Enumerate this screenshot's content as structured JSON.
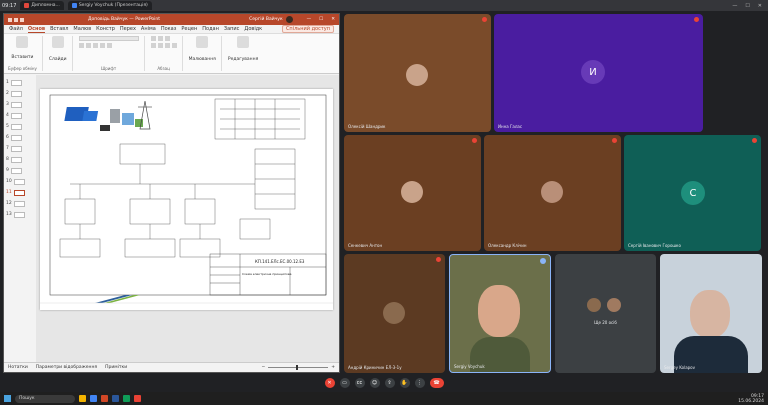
{
  "browser": {
    "clock": "09:17",
    "tabs": [
      {
        "label": "Дипломна..."
      },
      {
        "label": "Sergiy Voychuk (Презентація)"
      }
    ]
  },
  "ppt": {
    "title_doc": "Доповідь Вайчук — PowerPoint",
    "user_name": "Сергій Вайчук",
    "menu": [
      "Файл",
      "Основ",
      "Вставл",
      "Малюв",
      "Констр",
      "Перех",
      "Аніма",
      "Показ",
      "Рецен",
      "Подан",
      "Запис",
      "Довідк"
    ],
    "share": "Спільний доступ",
    "ribbon": {
      "paste": "Вставити",
      "clipboard": "Буфер обміну",
      "slides": "Слайди",
      "font": "Шрифт",
      "paragraph": "Абзац",
      "drawing": "Малювання",
      "editing": "Редагування"
    },
    "thumb_numbers": [
      "7",
      "8",
      "9",
      "10",
      "11",
      "12",
      "13"
    ],
    "thumb_numbers_top": [
      "1",
      "2",
      "3",
      "4",
      "5",
      "6"
    ],
    "slide": {
      "stamp_code": "КП.141.ЕЛс.ЕС.00.12.Е3",
      "stamp_desc": "Схема електрична принципова"
    },
    "status": {
      "notes": "Нотатки",
      "display": "Параметри відображення",
      "comments": "Примітки"
    }
  },
  "participants": [
    {
      "name": "Олексій Шандрик"
    },
    {
      "name": "Инна Галас",
      "initial": "И",
      "color": "#673ab7"
    },
    {
      "name": "Сенкевич Антон"
    },
    {
      "name": "Олександр Клічин"
    },
    {
      "name": "Сергій Іванович Горошко",
      "initial": "С",
      "color": "#1e8f7c"
    },
    {
      "name": "Андрій Криничин ЕЛ-3-1у"
    },
    {
      "name": "Sergiy Voychuk"
    },
    {
      "name": "Ще 20 осіб"
    },
    {
      "name": "Sergey Kolapov"
    }
  ],
  "taskbar": {
    "search": "Пошук",
    "time": "09:17",
    "date": "15.06.2024"
  }
}
